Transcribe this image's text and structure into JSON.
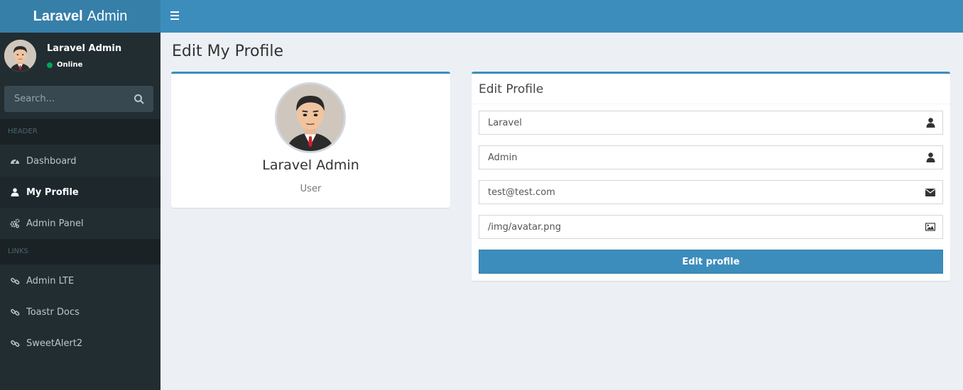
{
  "app": {
    "logo_bold": "Laravel",
    "logo_light": "Admin"
  },
  "sidebar": {
    "user": {
      "name": "Laravel Admin",
      "status": "Online",
      "status_color": "#00a65a"
    },
    "search": {
      "placeholder": "Search..."
    },
    "sections": [
      {
        "header": "HEADER"
      },
      {
        "header": "LINKS"
      }
    ],
    "items": [
      {
        "label": "Dashboard",
        "icon": "dashboard-icon",
        "active": false
      },
      {
        "label": "My Profile",
        "icon": "user-icon",
        "active": true
      },
      {
        "label": "Admin Panel",
        "icon": "cogs-icon",
        "active": false
      },
      {
        "label": "Admin LTE",
        "icon": "link-icon",
        "active": false
      },
      {
        "label": "Toastr Docs",
        "icon": "link-icon",
        "active": false
      },
      {
        "label": "SweetAlert2",
        "icon": "link-icon",
        "active": false
      }
    ]
  },
  "main": {
    "page_title": "Edit My Profile",
    "profile_card": {
      "name": "Laravel Admin",
      "role": "User"
    },
    "edit_form": {
      "title": "Edit Profile",
      "fields": [
        {
          "value": "Laravel",
          "icon": "user-icon"
        },
        {
          "value": "Admin",
          "icon": "user-icon"
        },
        {
          "value": "test@test.com",
          "icon": "envelope-icon"
        },
        {
          "value": "/img/avatar.png",
          "icon": "image-icon"
        }
      ],
      "submit_label": "Edit profile"
    }
  },
  "colors": {
    "brand": "#3c8dbc",
    "brand_dark": "#367fa9",
    "sidebar_bg": "#222d32",
    "content_bg": "#ecf0f5"
  }
}
